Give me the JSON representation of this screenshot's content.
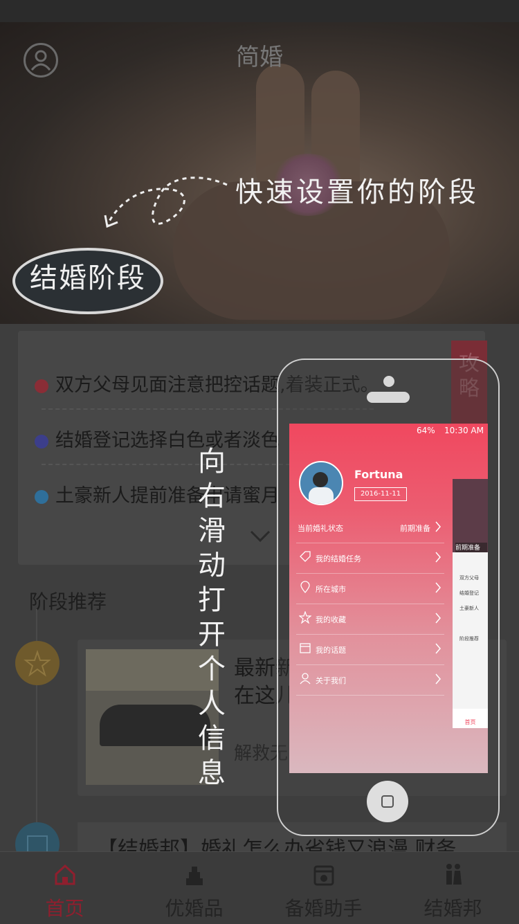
{
  "app": {
    "title": "简婚"
  },
  "hero": {
    "hint": "快速设置你的阶段",
    "stage_button": "结婚阶段"
  },
  "tips": [
    {
      "text": "双方父母见面注意把控话题,着装正式。",
      "color": "#8a2d36"
    },
    {
      "text": "结婚登记选择白色或者淡色",
      "color": "#3c3e8a"
    },
    {
      "text": "土豪新人提前准备申请蜜月",
      "color": "#2f6f9a"
    }
  ],
  "strategy_tab": "攻略",
  "section": {
    "title": "阶段推荐"
  },
  "articles": [
    {
      "title": "最新新婚宴\n在这儿",
      "subtitle": "解救无"
    },
    {
      "title": "【结婚邦】婚礼怎么办省钱又浪漫 财务..."
    }
  ],
  "swipe_hint": "向右滑动打开个人信息",
  "drawer": {
    "status_bar": {
      "time": "10:30 AM",
      "battery": "64%"
    },
    "user": {
      "name": "Fortuna",
      "date": "2016-11-11"
    },
    "status_row": {
      "label": "当前婚礼状态",
      "value": "前期准备"
    },
    "menu": [
      {
        "label": "我的结婚任务",
        "icon": "tag-icon"
      },
      {
        "label": "所在城市",
        "icon": "location-icon"
      },
      {
        "label": "我的收藏",
        "icon": "star-icon"
      },
      {
        "label": "我的话题",
        "icon": "calendar-icon"
      },
      {
        "label": "关于我们",
        "icon": "person-icon"
      }
    ],
    "peek": {
      "tag": "前期准备",
      "tips": [
        "双方父母",
        "结婚登记",
        "土豪新人"
      ],
      "section": "阶段推荐",
      "tab": "首页"
    }
  },
  "tabbar": [
    {
      "label": "首页",
      "icon": "home-icon",
      "active": true
    },
    {
      "label": "优婚品",
      "icon": "cake-icon",
      "active": false
    },
    {
      "label": "备婚助手",
      "icon": "calendar-icon",
      "active": false
    },
    {
      "label": "结婚邦",
      "icon": "couple-icon",
      "active": false
    }
  ],
  "colors": {
    "accent": "#f0485f",
    "active_tab": "#8f1f2e"
  }
}
